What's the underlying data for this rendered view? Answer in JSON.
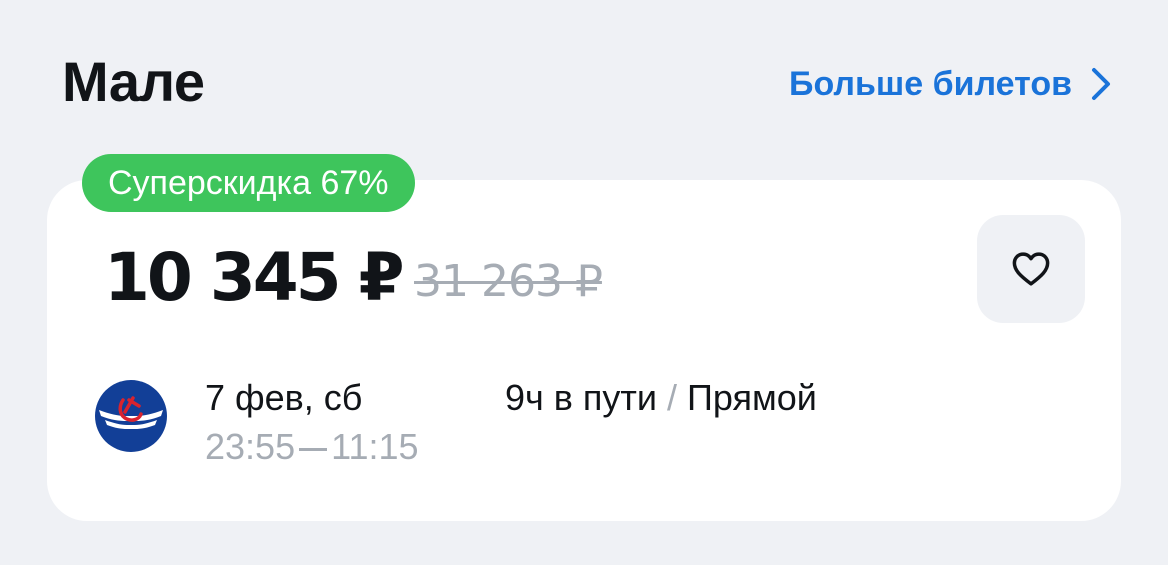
{
  "header": {
    "title": "Мале",
    "more_label": "Больше билетов"
  },
  "ticket": {
    "badge": "Суперскидка 67%",
    "price": "10 345 ₽",
    "old_price": "31 263 ₽",
    "date": "7 фев, сб",
    "departure_time": "23:55",
    "arrival_time": "11:15",
    "duration": "9ч в пути",
    "separator": "/",
    "route_type": "Прямой",
    "favorite_icon": "heart-outline-icon",
    "airline_logo": "aeroflot-logo"
  },
  "colors": {
    "accent": "#1a73d9",
    "badge": "#3ec55c",
    "muted": "#a6acb4",
    "logo_blue": "#123f97"
  }
}
